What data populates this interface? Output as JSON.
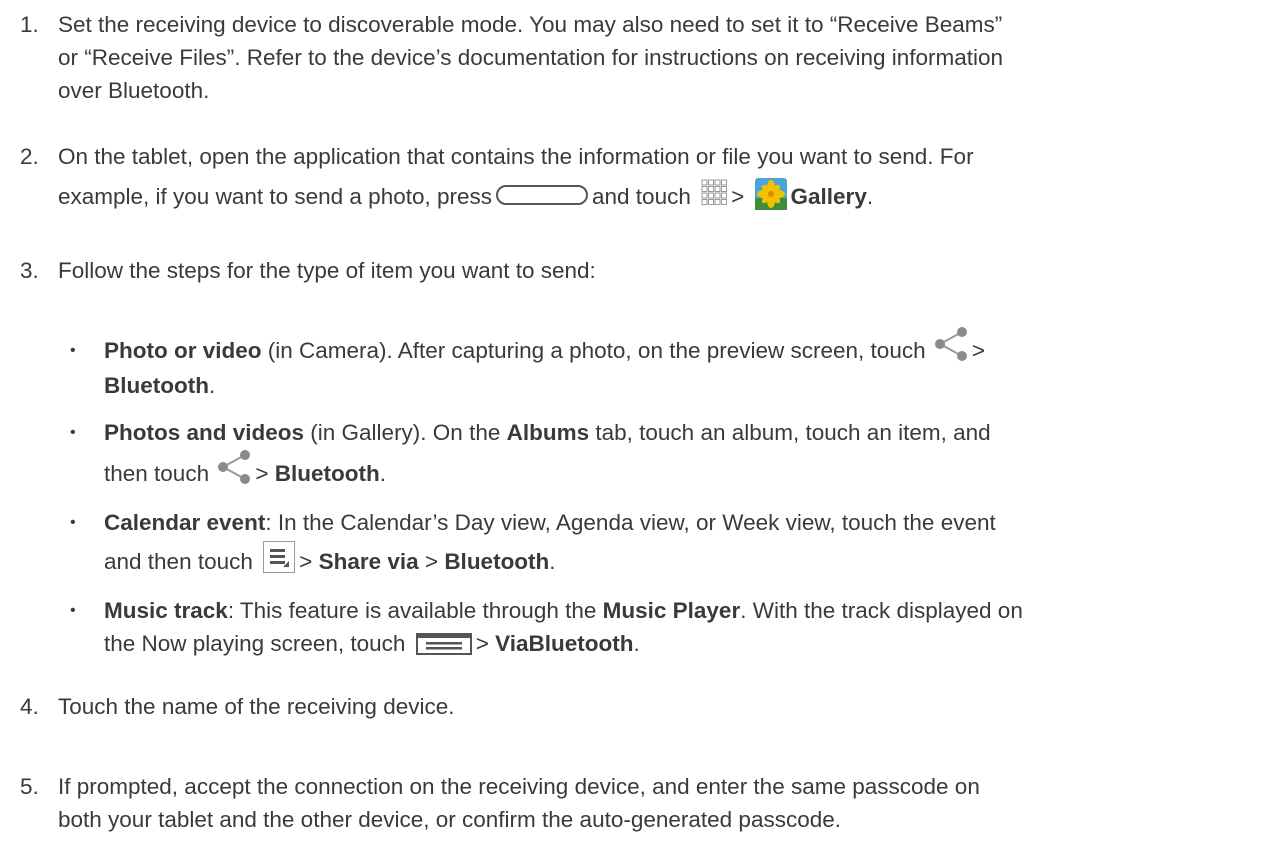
{
  "steps": [
    {
      "number": "1.",
      "lines": [
        "Set the receiving device to discoverable mode. You may also need to set it to “Receive Beams”",
        "or “Receive Files”. Refer to the device’s documentation for instructions on receiving information",
        "over Bluetooth."
      ]
    },
    {
      "number": "2.",
      "line1": "On the tablet, open the application that contains the information or file you want to send. For",
      "line2_a": "example, if you want to send a photo, press",
      "line2_b": "and touch",
      "line2_c": ">",
      "line2_gallery": "Gallery",
      "line2_end": "."
    },
    {
      "number": "3.",
      "text": "Follow the steps for the type of item you want to send:"
    },
    {
      "number": "4.",
      "text": "Touch the name of the receiving device."
    },
    {
      "number": "5.",
      "lines": [
        "If prompted, accept the connection on the receiving device, and enter the same passcode on",
        "both your tablet and the other device, or confirm the auto-generated passcode."
      ]
    }
  ],
  "bullets": [
    {
      "bold": "Photo or video",
      "text_a": " (in Camera). After capturing a photo, on the preview screen, touch",
      "text_b": ">",
      "bold2": "Bluetooth",
      "end": "."
    },
    {
      "bold": "Photos and videos",
      "text_a": " (in Gallery). On the ",
      "bold_tab": "Albums",
      "text_b": " tab, touch an album, touch an item, and",
      "text_c": "then touch",
      "text_d": ">",
      "bold2": "Bluetooth",
      "end": "."
    },
    {
      "bold": "Calendar event",
      "text_a": ": In the Calendar’s Day view, Agenda view, or Week view, touch the event",
      "text_b": "and then touch",
      "text_c": ">",
      "bold_share": "Share via",
      "text_d": ">",
      "bold2": "Bluetooth",
      "end": "."
    },
    {
      "bold": "Music track",
      "text_a": ": This feature is available through the ",
      "bold_player": "Music Player",
      "text_b": ". With the track displayed on",
      "text_c": "the Now playing screen, touch",
      "text_d": ">",
      "bold2": "ViaBluetooth",
      "end": "."
    }
  ],
  "bullet_char": "•",
  "icons": {
    "home_key": "home-key-icon",
    "apps": "apps-grid-icon",
    "gallery": "gallery-icon",
    "share": "share-icon",
    "menu": "menu-icon",
    "menu_bar": "menu-bar-icon"
  },
  "colors": {
    "text": "#3a3a3a",
    "icon_gray": "#8a8a8a",
    "gallery_yellow": "#f2c200",
    "gallery_blue": "#4aa6d8"
  }
}
